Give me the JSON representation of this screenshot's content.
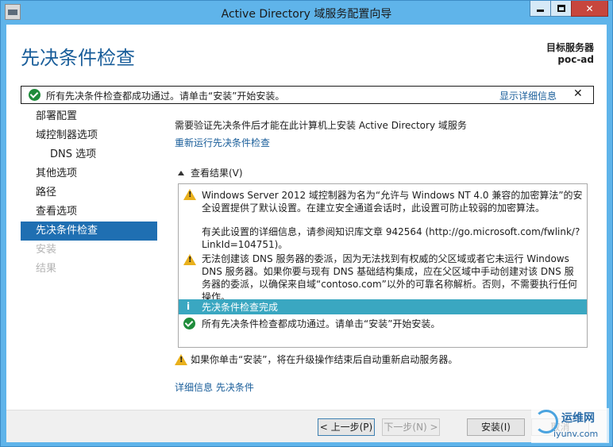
{
  "window": {
    "title": "Active Directory 域服务配置向导"
  },
  "header": {
    "title": "先决条件检查",
    "target_label": "目标服务器",
    "target_server": "poc-ad"
  },
  "notice": {
    "message": "所有先决条件检查都成功通过。请单击“安装”开始安装。",
    "details_link": "显示详细信息",
    "close": "✕"
  },
  "nav": {
    "items": [
      {
        "label": "部署配置"
      },
      {
        "label": "域控制器选项"
      },
      {
        "label": "DNS 选项"
      },
      {
        "label": "其他选项"
      },
      {
        "label": "路径"
      },
      {
        "label": "查看选项"
      },
      {
        "label": "先决条件检查"
      },
      {
        "label": "安装"
      },
      {
        "label": "结果"
      }
    ]
  },
  "main": {
    "intro": "需要验证先决条件后才能在此计算机上安装 Active Directory 域服务",
    "rerun_link": "重新运行先决条件检查",
    "results_header": "查看结果(V)",
    "results": {
      "warning1_a": "Windows Server 2012 域控制器为名为“允许与 Windows NT 4.0 兼容的加密算法”的安全设置提供了默认设置。在建立安全通道会话时，此设置可防止较弱的加密算法。",
      "warning1_b": "有关此设置的详细信息，请参阅知识库文章 942564 (http://go.microsoft.com/fwlink/?LinkId=104751)。",
      "warning2": "无法创建该 DNS 服务器的委派，因为无法找到有权威的父区域或者它未运行 Windows DNS 服务器。如果你要与现有 DNS 基础结构集成，应在父区域中手动创建对该 DNS 服务器的委派，以确保来自域“contoso.com”以外的可靠名称解析。否则，不需要执行任何操作。",
      "info_label": "i",
      "info": "先决条件检查完成",
      "success": "所有先决条件检查都成功通过。请单击“安装”开始安装。"
    },
    "bottom_warning": "如果你单击“安装”，将在升级操作结束后自动重新启动服务器。",
    "more_links": "详细信息 先决条件"
  },
  "footer": {
    "prev": "< 上一步(P)",
    "next": "下一步(N) >",
    "install": "安装(I)",
    "cancel": "取消"
  },
  "watermark": {
    "brand": "运维网",
    "url": "iyunv.com"
  }
}
